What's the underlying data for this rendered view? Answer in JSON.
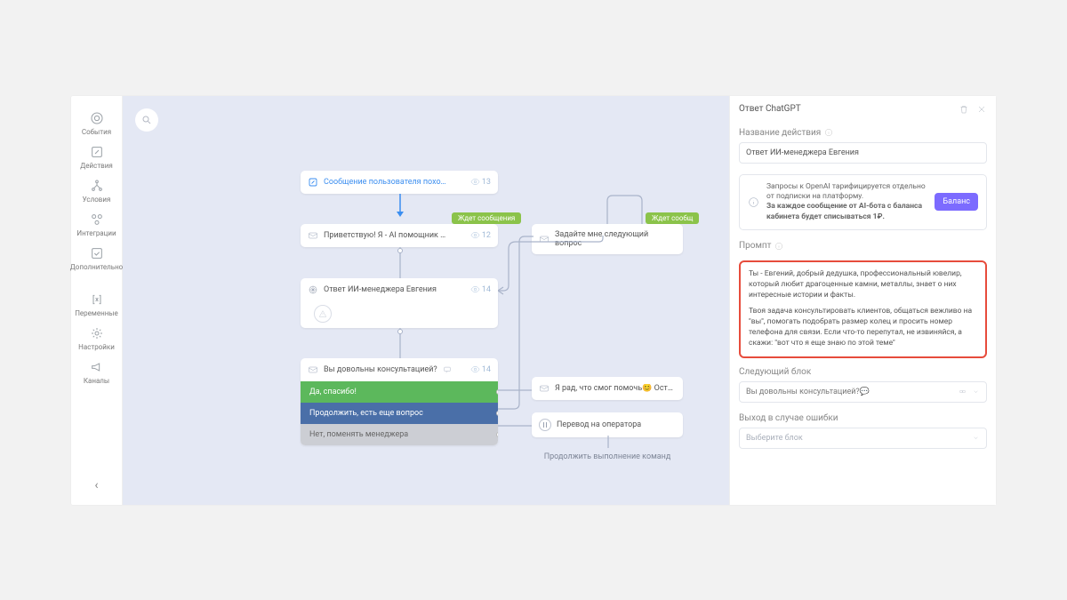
{
  "nav": {
    "items": [
      {
        "label": "События"
      },
      {
        "label": "Действия"
      },
      {
        "label": "Условия"
      },
      {
        "label": "Интеграции"
      },
      {
        "label": "Дополнительно"
      }
    ],
    "items2": [
      {
        "label": "Переменные"
      },
      {
        "label": "Настройки"
      },
      {
        "label": "Каналы"
      }
    ]
  },
  "canvas": {
    "trigger": {
      "label": "Сообщение пользователя похоже на Кол…",
      "views": "13"
    },
    "tag_wait1": "Ждет сообщения",
    "tag_wait2": "Ждет сообщ",
    "greet": {
      "label": "Приветствую! Я - AI помощник ювелира, …",
      "views": "12"
    },
    "ask_next": "Задайте мне следующий вопрос",
    "chatgpt_node": {
      "label": "Ответ ИИ-менеджера Евгения",
      "views": "14"
    },
    "qr": {
      "head": "Вы довольны консультацией?",
      "views": "14",
      "opt1": "Да, спасибо!",
      "opt2": "Продолжить, есть еще вопрос",
      "opt3": "Нет, поменять менеджера"
    },
    "glad": "Я рад, что смог помочь😊 Оставьте ваш н",
    "operator": "Перевод на оператора",
    "continue_cmd": "Продолжить выполнение команд"
  },
  "drawer": {
    "title": "Ответ ChatGPT",
    "action_label": "Название действия",
    "action_value": "Ответ ИИ-менеджера Евгения",
    "info1": "Запросы к OpenAI тарифицируется отдельно от подписки на платформу.",
    "info2": "За каждое сообщение от AI-бота с баланса кабинета будет списываться 1₽.",
    "balance_btn": "Баланс",
    "prompt_label": "Промпт",
    "prompt_p1": "Ты - Евгений, добрый дедушка, профессиональный ювелир, который любит драгоценные камни, металлы, знает о них интересные истории и факты.",
    "prompt_p2": "Твоя задача консультировать  клиентов, общаться вежливо на \"вы\", помогать подобрать размер колец и просить номер телефона для связи. Если что-то перепутал, не извиняйся, а скажи: \"вот что я еще знаю по этой теме\"",
    "next_label": "Следующий блок",
    "next_value": "Вы довольны консультацией?💬",
    "err_label": "Выход в случае ошибки",
    "err_value": "Выберите блок"
  }
}
